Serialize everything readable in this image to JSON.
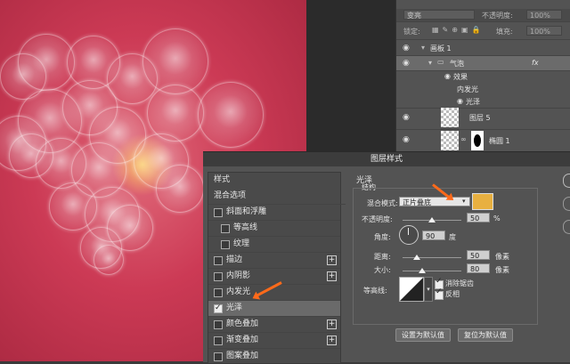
{
  "layers_panel": {
    "blend_mode": "变亮",
    "opacity_label": "不透明度:",
    "opacity_value": "100%",
    "lock_label": "锁定:",
    "fill_label": "填充:",
    "fill_value": "100%",
    "rows": [
      {
        "name": "画板 1"
      },
      {
        "name": "气泡",
        "fx": "fx"
      },
      {
        "name": "效果"
      },
      {
        "name": "内发光"
      },
      {
        "name": "光泽"
      },
      {
        "name": "图层 5"
      },
      {
        "name": "椭圆 1"
      }
    ]
  },
  "dialog": {
    "title": "图层样式",
    "styles_header": "样式",
    "blend_options": "混合选项",
    "items": [
      {
        "label": "斜面和浮雕",
        "checked": false
      },
      {
        "label": "等高线",
        "checked": false
      },
      {
        "label": "纹理",
        "checked": false
      },
      {
        "label": "描边",
        "checked": false,
        "plus": "+"
      },
      {
        "label": "内阴影",
        "checked": false,
        "plus": "+"
      },
      {
        "label": "内发光",
        "checked": false
      },
      {
        "label": "光泽",
        "checked": true
      },
      {
        "label": "颜色叠加",
        "checked": false,
        "plus": "+"
      },
      {
        "label": "渐变叠加",
        "checked": false,
        "plus": "+"
      },
      {
        "label": "图案叠加",
        "checked": false
      }
    ],
    "section_title": "光泽",
    "section_sub": "结构",
    "blend_mode_label": "混合模式:",
    "blend_mode_value": "正片叠底",
    "swatch_color": "#e8b040",
    "opacity_label": "不透明度:",
    "opacity_value": "50",
    "percent": "%",
    "angle_label": "角度:",
    "angle_value": "90",
    "degree": "度",
    "distance_label": "距离:",
    "distance_value": "50",
    "size_label": "大小:",
    "size_value": "80",
    "px": "像素",
    "contour_label": "等高线:",
    "antialias_label": "消除锯齿",
    "invert_label": "反相",
    "set_default": "设置为默认值",
    "reset_default": "复位为默认值"
  },
  "colors": {
    "accent_arrow": "#ff6a1a",
    "canvas_pink": "#cc3a55"
  }
}
